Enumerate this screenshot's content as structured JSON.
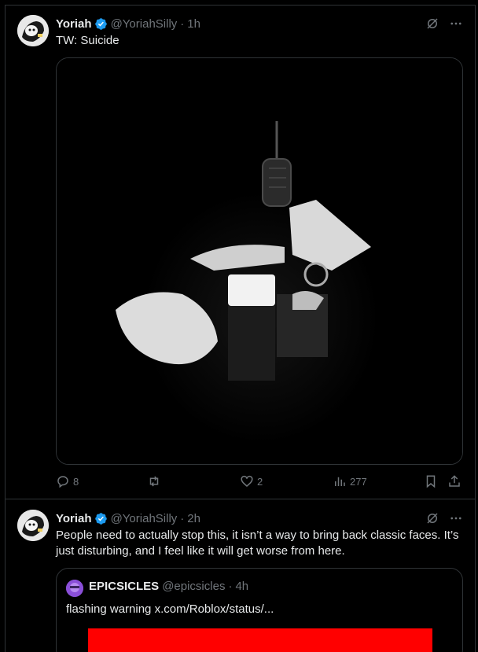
{
  "tweets": [
    {
      "name": "Yoriah",
      "handle": "@YoriahSilly",
      "time": "1h",
      "text": "TW: Suicide",
      "replies": "8",
      "retweets": "",
      "likes": "2",
      "views": "277"
    },
    {
      "name": "Yoriah",
      "handle": "@YoriahSilly",
      "time": "2h",
      "text": "People need to actually stop this, it isn’t a way to bring back classic faces. It’s just disturbing, and I feel like it will get worse from here."
    }
  ],
  "quote": {
    "name": "EPICSICLES",
    "handle": "@epicsicles",
    "time": "4h",
    "text": "flashing warning  x.com/Roblox/status/..."
  },
  "separator": "·",
  "colors": {
    "bg": "#000000",
    "text": "#e7e9ea",
    "muted": "#71767b",
    "border": "#2f3336",
    "verified": "#1d9bf0",
    "quote_media": "#ff0000"
  },
  "icons": [
    "verified-badge-icon",
    "grok-icon",
    "more-icon",
    "reply-icon",
    "retweet-icon",
    "like-icon",
    "views-icon",
    "bookmark-icon",
    "share-icon"
  ]
}
